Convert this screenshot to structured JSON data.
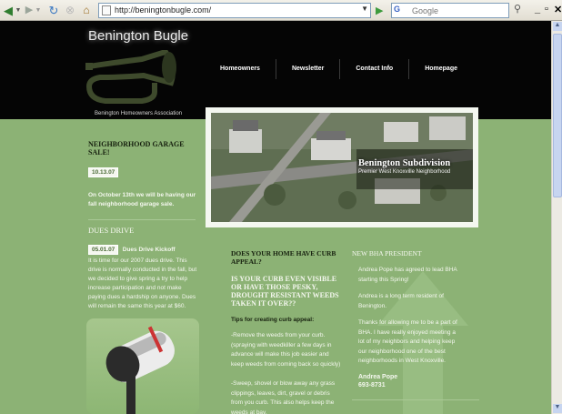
{
  "browser": {
    "url": "http://beningtonbugle.com/",
    "search_placeholder": "Google",
    "search_engine": "G",
    "icons": [
      "back-arrow-icon",
      "forward-arrow-icon",
      "reload-icon",
      "stop-icon",
      "home-icon",
      "page-icon",
      "go-arrow-icon",
      "magnifier-icon"
    ]
  },
  "site": {
    "title": "Benington Bugle",
    "subtitle": "Benington Homeowners Association",
    "nav": [
      {
        "label": "Homeowners"
      },
      {
        "label": "Newsletter"
      },
      {
        "label": "Contact Info"
      },
      {
        "label": "Homepage"
      }
    ]
  },
  "hero": {
    "title": "Benington Subdivision",
    "subtitle": "Premier West Knoxville Neighborhood"
  },
  "left": {
    "garage_title": "Neighborhood Garage Sale!",
    "garage_date": "10.13.07",
    "garage_text": "On October 13th we will be having our fall neighborhood garage sale.",
    "dues_title": "Dues Drive",
    "dues_date": "05.01.07",
    "dues_kick": "Dues Drive Kickoff",
    "dues_text": "It is time for our 2007 dues drive. This drive is normally conducted in the fall, but we decided to give spring a try to help increase participation and not make paying dues a hardship on anyone. Dues will remain the same this year at $60."
  },
  "middle": {
    "heading1": "Does your home have curb appeal?",
    "heading2": "Is your curb even visible or have those pesky, drought resistant weeds taken it over??",
    "tips_label": "Tips for creating curb appeal:",
    "tip1": "-Remove the weeds from your curb. (spraying with weedkiller a few days in advance will make this job easier and keep weeds from coming back so quickly)",
    "tip2": "-Sweep, shovel or blow away any grass clippings, leaves, dirt, gravel or debris from you curb. This also helps keep the weeds at bay."
  },
  "right": {
    "heading": "New BHA President",
    "p1": "Andrea Pope has agreed to lead BHA starting this Spring!",
    "p2": "Andrea is a long term resident of Benington.",
    "p3": "Thanks for allowing me to be a part of BHA. I have really enjoyed meeting a lot of my neighbors and helping keep our neighborhood one of the best neighborhoods in West Knoxville.",
    "name": "Andrea Pope",
    "phone": "693-8731"
  },
  "colors": {
    "page_green": "#8cb275",
    "header_black": "#050505",
    "heading_dark": "#17210f"
  }
}
